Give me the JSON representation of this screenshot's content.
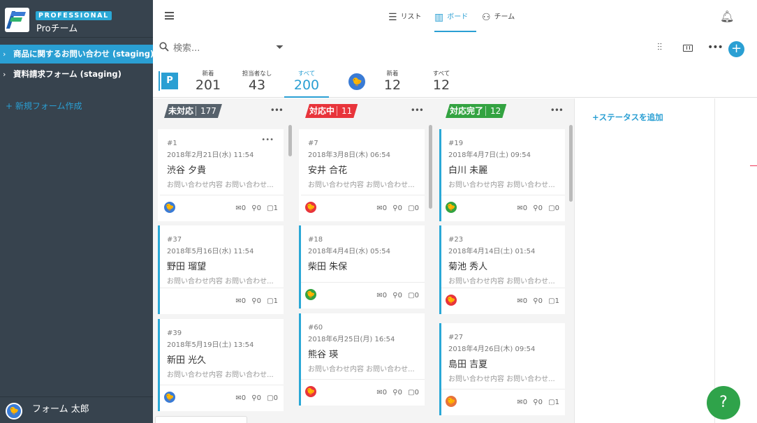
{
  "sidebar": {
    "plan": "PROFESSIONAL",
    "team": "Proチーム",
    "forms": [
      {
        "label": "商品に関するお問い合わせ (staging)"
      },
      {
        "label": "資料請求フォーム (staging)"
      }
    ],
    "new_form": "+ 新規フォーム作成",
    "user_name": "フォーム 太郎"
  },
  "topbar": {
    "tabs": [
      {
        "label": "リスト",
        "icon": "list-icon"
      },
      {
        "label": "ボード",
        "icon": "board-icon"
      },
      {
        "label": "チーム",
        "icon": "team-icon"
      }
    ],
    "active_tab": "ボード"
  },
  "filter": {
    "search_placeholder": "検索..."
  },
  "stats": {
    "badge": "P",
    "project": [
      {
        "label": "新着",
        "value": "201"
      },
      {
        "label": "担当者なし",
        "value": "43"
      },
      {
        "label": "すべて",
        "value": "200"
      }
    ],
    "user": [
      {
        "label": "新着",
        "value": "12"
      },
      {
        "label": "すべて",
        "value": "12"
      }
    ]
  },
  "columns": [
    {
      "title": "未対応",
      "count": "177",
      "color": "#56616b",
      "cards": [
        {
          "num": "#1",
          "date": "2018年2月21日(水) 11:54",
          "name": "渋谷 夕貴",
          "snippet": "お問い合わせ内容 お問い合わせ...",
          "mail": "0",
          "clip": "0",
          "note": "1"
        },
        {
          "num": "#37",
          "date": "2018年5月16日(水) 11:54",
          "name": "野田 瑠望",
          "snippet": "お問い合わせ内容 お問い合わせ...",
          "mail": "0",
          "clip": "0",
          "note": "1"
        },
        {
          "num": "#39",
          "date": "2018年5月19日(土) 13:54",
          "name": "新田 光久",
          "snippet": "お問い合わせ内容 お問い合わせ...",
          "mail": "0",
          "clip": "0",
          "note": "0"
        }
      ]
    },
    {
      "title": "対応中",
      "count": "11",
      "color": "#e8343b",
      "cards": [
        {
          "num": "#7",
          "date": "2018年3月8日(木) 06:54",
          "name": "安井 合花",
          "snippet": "お問い合わせ内容 お問い合わせ...",
          "mail": "0",
          "clip": "0",
          "note": "0"
        },
        {
          "num": "#18",
          "date": "2018年4月4日(水) 05:54",
          "name": "柴田 朱保",
          "snippet": "お問い合わせ内容 お問い合わせ...",
          "mail": "0",
          "clip": "0",
          "note": "0"
        },
        {
          "num": "#60",
          "date": "2018年6月25日(月) 16:54",
          "name": "熊谷 瑛",
          "snippet": "お問い合わせ内容 お問い合わせ...",
          "mail": "0",
          "clip": "0",
          "note": "0"
        }
      ]
    },
    {
      "title": "対応完了",
      "count": "12",
      "color": "#33a341",
      "cards": [
        {
          "num": "#19",
          "date": "2018年4月7日(土) 09:54",
          "name": "白川 未麗",
          "snippet": "お問い合わせ内容 お問い合わせ...",
          "mail": "0",
          "clip": "0",
          "note": "0"
        },
        {
          "num": "#23",
          "date": "2018年4月14日(土) 01:54",
          "name": "菊池 秀人",
          "snippet": "お問い合わせ内容 お問い合わせ...",
          "mail": "0",
          "clip": "0",
          "note": "1"
        },
        {
          "num": "#27",
          "date": "2018年4月26日(木) 09:54",
          "name": "島田 吉夏",
          "snippet": "お問い合わせ内容 お問い合わせ...",
          "mail": "0",
          "clip": "0",
          "note": "1"
        }
      ]
    }
  ],
  "add_status": "+ステータスを追加",
  "help": "?"
}
